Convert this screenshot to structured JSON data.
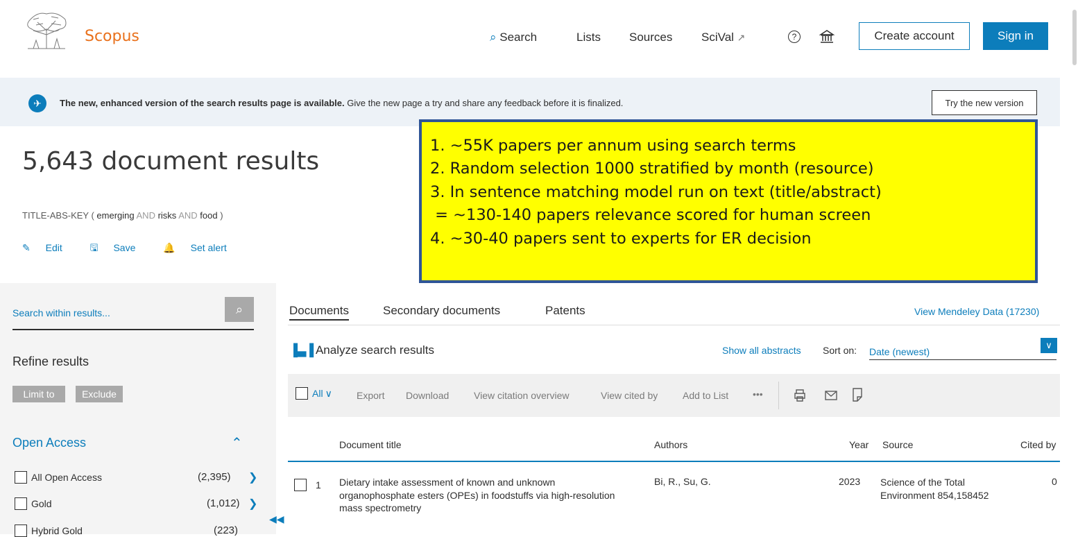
{
  "header": {
    "brand": "Scopus",
    "nav": {
      "search": "Search",
      "lists": "Lists",
      "sources": "Sources",
      "scival": "SciVal",
      "scival_ext": "↗"
    },
    "create_account": "Create account",
    "sign_in": "Sign in"
  },
  "banner": {
    "bold": "The new, enhanced version of the search results page is available.",
    "text": " Give the new page a try and share any feedback before it is finalized.",
    "button": "Try the new version"
  },
  "results": {
    "count_title": "5,643 document results",
    "query": {
      "field": "TITLE-ABS-KEY",
      "open": " ( ",
      "t1": "emerging",
      "op1": " AND ",
      "t2": "risks",
      "op2": " AND ",
      "t3": "food",
      "close": " )"
    },
    "actions": {
      "edit": "Edit",
      "save": "Save",
      "alert": "Set alert"
    }
  },
  "callout": {
    "lines": [
      "1. ~55K papers per annum using search terms",
      "2. Random selection 1000 stratified by month (resource)",
      "3. In sentence matching model run on text (title/abstract)",
      " = ~130-140 papers relevance scored for human screen",
      "4. ~30-40 papers sent to experts for ER decision"
    ]
  },
  "left_panel": {
    "search_placeholder": "Search within results...",
    "refine": "Refine results",
    "limit_to": "Limit to",
    "exclude": "Exclude",
    "open_access": {
      "title": "Open Access",
      "items": [
        {
          "label": "All Open Access",
          "count": "(2,395)"
        },
        {
          "label": "Gold",
          "count": "(1,012)"
        },
        {
          "label": "Hybrid Gold",
          "count": "(223)"
        }
      ]
    }
  },
  "main": {
    "tabs": [
      "Documents",
      "Secondary documents",
      "Patents"
    ],
    "mendeley": "View Mendeley Data (17230)",
    "analyze": "Analyze search results",
    "show_all_abstracts": "Show all abstracts",
    "sort_label": "Sort on:",
    "sort_value": "Date (newest)",
    "toolbar": {
      "all": "All",
      "export": "Export",
      "download": "Download",
      "view_citation_overview": "View citation overview",
      "view_cited_by": "View cited by",
      "add_to_list": "Add to List",
      "more": "•••"
    },
    "columns": {
      "title": "Document title",
      "authors": "Authors",
      "year": "Year",
      "source": "Source",
      "cited_by": "Cited by"
    },
    "rows": [
      {
        "num": "1",
        "title": "Dietary intake assessment of known and unknown organophosphate esters (OPEs) in foodstuffs via high-resolution mass spectrometry",
        "authors": "Bi, R., Su, G.",
        "year": "2023",
        "source": "Science of the Total Environment 854,158452",
        "cited_by": "0"
      }
    ]
  },
  "colors": {
    "accent": "#0c7dbb",
    "brand": "#e9711c",
    "callout_bg": "#ffff00",
    "callout_border": "#2f5597"
  }
}
